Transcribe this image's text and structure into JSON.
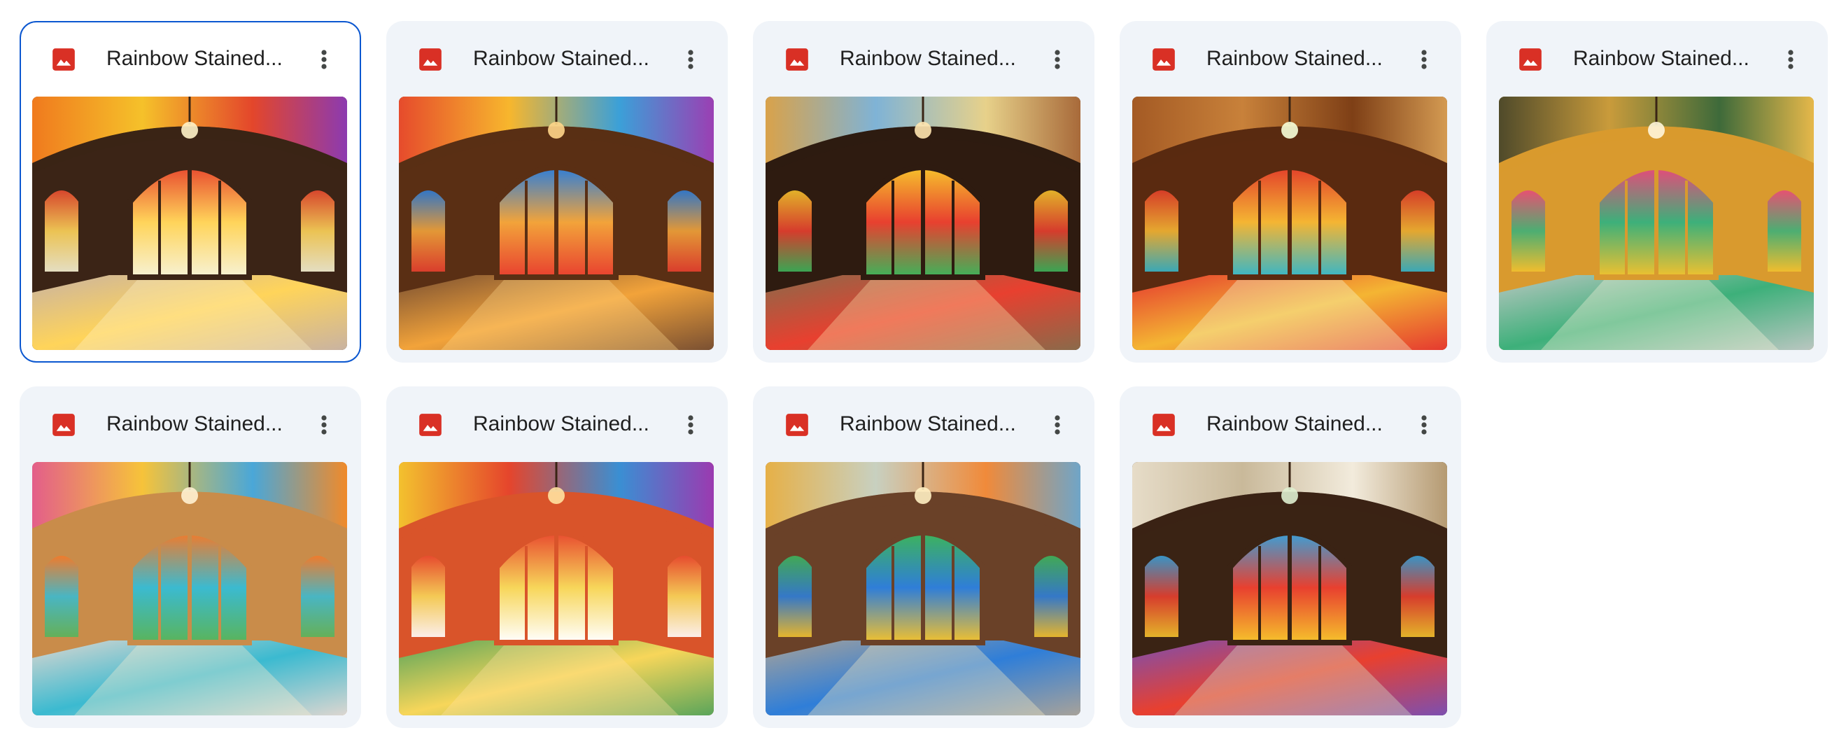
{
  "files": [
    {
      "name": "Rainbow Stained...",
      "type_icon": "image-file-icon",
      "selected": true,
      "palette": {
        "ceiling": [
          "#f07a1e",
          "#f5c12a",
          "#e3462b",
          "#8c3ab0"
        ],
        "walls": "#3b2416",
        "floor": "#c9b3a1",
        "window": [
          "#ffd45a",
          "#e84b2f",
          "#f7f2d4"
        ],
        "light": "#fff3c8"
      }
    },
    {
      "name": "Rainbow Stained...",
      "type_icon": "image-file-icon",
      "selected": false,
      "palette": {
        "ceiling": [
          "#e64b2c",
          "#f7b62d",
          "#3ba0d8",
          "#9b3fb3"
        ],
        "walls": "#5a2f14",
        "floor": "#7a5032",
        "window": [
          "#f2a33a",
          "#2f7ed8",
          "#e8402f"
        ],
        "light": "#ffd68a"
      }
    },
    {
      "name": "Rainbow Stained...",
      "type_icon": "image-file-icon",
      "selected": false,
      "palette": {
        "ceiling": [
          "#d9a24a",
          "#7fb3d6",
          "#e7d18a",
          "#a86a3a"
        ],
        "walls": "#2e1b10",
        "floor": "#8a6a4a",
        "window": [
          "#e8402f",
          "#f6c22c",
          "#3db45a"
        ],
        "light": "#ffe6b0"
      }
    },
    {
      "name": "Rainbow Stained...",
      "type_icon": "image-file-icon",
      "selected": false,
      "palette": {
        "ceiling": [
          "#a45a24",
          "#c8813a",
          "#7e3f16",
          "#d49a52"
        ],
        "walls": "#5a2a10",
        "floor": "#e53a2f",
        "window": [
          "#f4b533",
          "#e3402a",
          "#37b6c8"
        ],
        "light": "#f7ffd9"
      }
    },
    {
      "name": "Rainbow Stained...",
      "type_icon": "image-file-icon",
      "selected": false,
      "palette": {
        "ceiling": [
          "#4f4a2a",
          "#c99b3b",
          "#3e6a3a",
          "#e6b84a"
        ],
        "walls": "#d99a2e",
        "floor": "#b9c6c0",
        "window": [
          "#3db07a",
          "#e74a7a",
          "#f2c12e"
        ],
        "light": "#fff6dc"
      }
    },
    {
      "name": "Rainbow Stained...",
      "type_icon": "image-file-icon",
      "selected": false,
      "palette": {
        "ceiling": [
          "#e35e8a",
          "#f6c33a",
          "#4aa7d8",
          "#f08a2a"
        ],
        "walls": "#c98c4a",
        "floor": "#dcd6d0",
        "window": [
          "#3bbad0",
          "#f27a2a",
          "#5ab45a"
        ],
        "light": "#fff1d2"
      }
    },
    {
      "name": "Rainbow Stained...",
      "type_icon": "image-file-icon",
      "selected": false,
      "palette": {
        "ceiling": [
          "#f3c12e",
          "#e5452c",
          "#3a8fd3",
          "#9b3ab0"
        ],
        "walls": "#d9542a",
        "floor": "#5aa55a",
        "window": [
          "#f7d65a",
          "#e84b2f",
          "#ffffff"
        ],
        "light": "#ffe2a0"
      }
    },
    {
      "name": "Rainbow Stained...",
      "type_icon": "image-file-icon",
      "selected": false,
      "palette": {
        "ceiling": [
          "#e6b047",
          "#c8d0c0",
          "#f08a3a",
          "#6fa5c8"
        ],
        "walls": "#6a4128",
        "floor": "#a7a29a",
        "window": [
          "#2f7ed8",
          "#3db45a",
          "#f2c12e"
        ],
        "light": "#fff0c2"
      }
    },
    {
      "name": "Rainbow Stained...",
      "type_icon": "image-file-icon",
      "selected": false,
      "palette": {
        "ceiling": [
          "#e6dcc8",
          "#c9b99a",
          "#f2ebdc",
          "#b59a72"
        ],
        "walls": "#3a2314",
        "floor": "#7c4fb0",
        "window": [
          "#e8402f",
          "#3aa0d8",
          "#f6c22c"
        ],
        "light": "#dff0d0"
      }
    }
  ],
  "colors": {
    "card_bg": "#f0f4f9",
    "selected_border": "#0b57d0",
    "image_icon_red": "#d93025",
    "title_text": "#1f1f1f",
    "more_icon": "#444746"
  },
  "icons": {
    "file_type": "image-file-icon",
    "overflow_menu": "more-vert-icon"
  }
}
